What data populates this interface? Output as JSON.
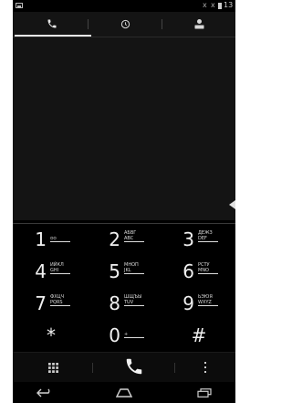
{
  "status_bar": {
    "signal_1": "x",
    "signal_2": "x",
    "time": "13"
  },
  "tabs": [
    {
      "name": "phone",
      "icon": "phone-icon",
      "selected": true
    },
    {
      "name": "recent",
      "icon": "clock-icon",
      "selected": false
    },
    {
      "name": "contacts",
      "icon": "contact-icon",
      "selected": false
    }
  ],
  "dialer": {
    "number_value": ""
  },
  "keypad": {
    "keys": [
      {
        "digit": "1",
        "letters": "",
        "sub": "ᴑᴑ"
      },
      {
        "digit": "2",
        "letters": "АБВГ",
        "sub": "ABC"
      },
      {
        "digit": "3",
        "letters": "ДЕЖЗ",
        "sub": "DEF"
      },
      {
        "digit": "4",
        "letters": "ИЙКЛ",
        "sub": "GHI"
      },
      {
        "digit": "5",
        "letters": "МНОП",
        "sub": "JKL"
      },
      {
        "digit": "6",
        "letters": "РСТУ",
        "sub": "MNO"
      },
      {
        "digit": "7",
        "letters": "ФХЦЧ",
        "sub": "PQRS"
      },
      {
        "digit": "8",
        "letters": "ШЩЪЫ",
        "sub": "TUV"
      },
      {
        "digit": "9",
        "letters": "ЬЭЮЯ",
        "sub": "WXYZ"
      },
      {
        "digit": "*",
        "letters": "",
        "sub": ""
      },
      {
        "digit": "0",
        "letters": "",
        "sub": "+"
      },
      {
        "digit": "#",
        "letters": "",
        "sub": ""
      }
    ]
  },
  "actions": {
    "dialpad_icon": "dialpad-icon",
    "call_icon": "phone-call-icon",
    "overflow_icon": "overflow-menu-icon"
  },
  "nav": {
    "back_icon": "back-icon",
    "home_icon": "home-icon",
    "recents_icon": "recents-icon"
  },
  "colors": {
    "background": "#000000",
    "panel": "#141414",
    "text": "#f0f0f0",
    "accent": "#e6e6e6"
  }
}
